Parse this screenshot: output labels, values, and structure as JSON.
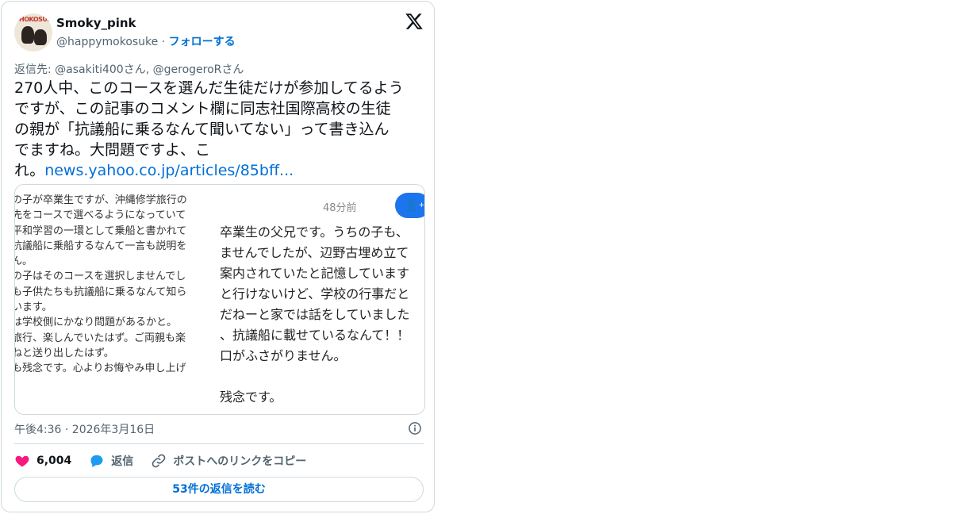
{
  "author": {
    "display_name": "Smoky_pink",
    "handle": "@happymokosuke",
    "separator": "·",
    "follow_label": "フォローする",
    "avatar_text": "HOKOSUKE"
  },
  "reply_to": "返信先: @asakiti400さん, @gerogeroRさん",
  "tweet": {
    "lines": [
      "270人中、このコースを選んだ生徒だけが参加してるよう",
      "ですが、この記事のコメント欄に同志社国際高校の生徒",
      "の親が「抗議船に乗るなんて聞いてない」って書き込ん",
      "でますね。大問題ですよ、こ",
      "れ。"
    ],
    "link_text": "news.yahoo.co.jp/articles/85bff..."
  },
  "embed": {
    "left_lines": [
      "の子が卒業生ですが、沖縄修学旅行の",
      "先をコースで選べるようになっていて",
      "平和学習の一環として乗船と書かれて",
      "抗議船に乗船するなんて一言も説明を",
      "ん。",
      "の子はそのコースを選択しませんでし",
      "も子供たちも抗議船に乗るなんて知ら",
      "います。",
      "は学校側にかなり問題があるかと。",
      "旅行、楽しんでいたはず。ご両親も楽",
      "ねと送り出したはず。",
      "も残念です。心よりお悔やみ申し上げ"
    ],
    "time": "48分前",
    "right_lines": [
      "卒業生の父兄です。うちの子も、",
      "ませんでしたが、辺野古埋め立て",
      "案内されていたと記憶しています",
      "と行けないけど、学校の行事だと",
      "だねーと家では話をしていました",
      "、抗議船に載せているなんて！！",
      "口がふさがりません。",
      "",
      "残念です。"
    ]
  },
  "timestamp": "午後4:36 · 2026年3月16日",
  "actions": {
    "likes": "6,004",
    "reply_label": "返信",
    "copy_link_label": "ポストへのリンクをコピー"
  },
  "read_replies_label": "53件の返信を読む",
  "colors": {
    "link": "#006fd6",
    "like": "#f91880",
    "reply": "#1d9bf0",
    "fab": "#1d75ed"
  }
}
